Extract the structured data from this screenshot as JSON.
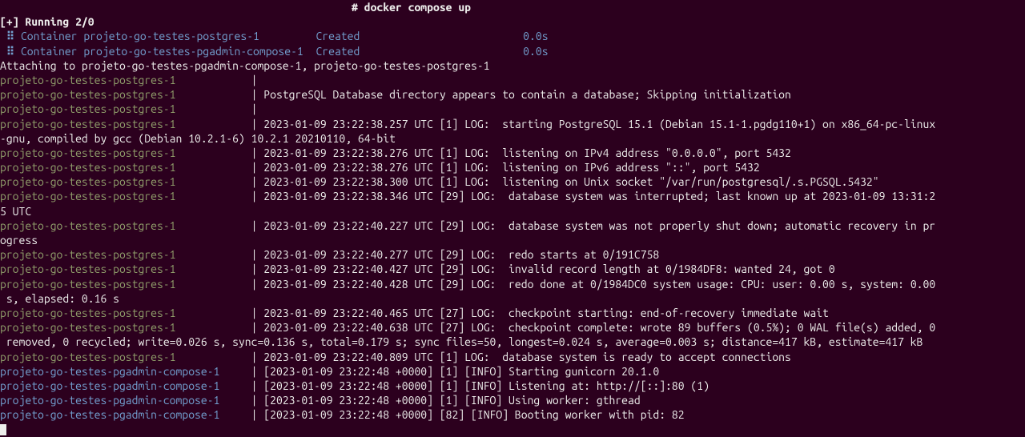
{
  "header": {
    "prefix": "                                                        # ",
    "command": "docker compose up"
  },
  "running": "[+] Running 2/0",
  "containers": [
    {
      "dots": " ⠿ ",
      "label": "Container projeto-go-testes-postgres-1         ",
      "status": "Created",
      "pad": "                          ",
      "time": "0.0s"
    },
    {
      "dots": " ⠿ ",
      "label": "Container projeto-go-testes-pgadmin-compose-1  ",
      "status": "Created",
      "pad": "                          ",
      "time": "0.0s"
    }
  ],
  "attaching": "Attaching to projeto-go-testes-pgadmin-compose-1, projeto-go-testes-postgres-1",
  "logs": [
    {
      "service": "projeto-go-testes-postgres-1",
      "color": "olive",
      "msg": ""
    },
    {
      "service": "projeto-go-testes-postgres-1",
      "color": "olive",
      "msg": "PostgreSQL Database directory appears to contain a database; Skipping initialization"
    },
    {
      "service": "projeto-go-testes-postgres-1",
      "color": "olive",
      "msg": ""
    },
    {
      "service": "projeto-go-testes-postgres-1",
      "color": "olive",
      "msg": "2023-01-09 23:22:38.257 UTC [1] LOG:  starting PostgreSQL 15.1 (Debian 15.1-1.pgdg110+1) on x86_64-pc-linux-gnu, compiled by gcc (Debian 10.2.1-6) 10.2.1 20210110, 64-bit"
    },
    {
      "service": "projeto-go-testes-postgres-1",
      "color": "olive",
      "msg": "2023-01-09 23:22:38.276 UTC [1] LOG:  listening on IPv4 address \"0.0.0.0\", port 5432"
    },
    {
      "service": "projeto-go-testes-postgres-1",
      "color": "olive",
      "msg": "2023-01-09 23:22:38.276 UTC [1] LOG:  listening on IPv6 address \"::\", port 5432"
    },
    {
      "service": "projeto-go-testes-postgres-1",
      "color": "olive",
      "msg": "2023-01-09 23:22:38.300 UTC [1] LOG:  listening on Unix socket \"/var/run/postgresql/.s.PGSQL.5432\""
    },
    {
      "service": "projeto-go-testes-postgres-1",
      "color": "olive",
      "msg": "2023-01-09 23:22:38.346 UTC [29] LOG:  database system was interrupted; last known up at 2023-01-09 13:31:25 UTC"
    },
    {
      "service": "projeto-go-testes-postgres-1",
      "color": "olive",
      "msg": "2023-01-09 23:22:40.227 UTC [29] LOG:  database system was not properly shut down; automatic recovery in progress"
    },
    {
      "service": "projeto-go-testes-postgres-1",
      "color": "olive",
      "msg": "2023-01-09 23:22:40.277 UTC [29] LOG:  redo starts at 0/191C758"
    },
    {
      "service": "projeto-go-testes-postgres-1",
      "color": "olive",
      "msg": "2023-01-09 23:22:40.427 UTC [29] LOG:  invalid record length at 0/1984DF8: wanted 24, got 0"
    },
    {
      "service": "projeto-go-testes-postgres-1",
      "color": "olive",
      "msg": "2023-01-09 23:22:40.428 UTC [29] LOG:  redo done at 0/1984DC0 system usage: CPU: user: 0.00 s, system: 0.00 s, elapsed: 0.16 s"
    },
    {
      "service": "projeto-go-testes-postgres-1",
      "color": "olive",
      "msg": "2023-01-09 23:22:40.465 UTC [27] LOG:  checkpoint starting: end-of-recovery immediate wait"
    },
    {
      "service": "projeto-go-testes-postgres-1",
      "color": "olive",
      "msg": "2023-01-09 23:22:40.638 UTC [27] LOG:  checkpoint complete: wrote 89 buffers (0.5%); 0 WAL file(s) added, 0 removed, 0 recycled; write=0.026 s, sync=0.136 s, total=0.179 s; sync files=50, longest=0.024 s, average=0.003 s; distance=417 kB, estimate=417 kB"
    },
    {
      "service": "projeto-go-testes-postgres-1",
      "color": "olive",
      "msg": "2023-01-09 23:22:40.809 UTC [1] LOG:  database system is ready to accept connections"
    },
    {
      "service": "projeto-go-testes-pgadmin-compose-1",
      "color": "blue",
      "msg": "[2023-01-09 23:22:48 +0000] [1] [INFO] Starting gunicorn 20.1.0"
    },
    {
      "service": "projeto-go-testes-pgadmin-compose-1",
      "color": "blue",
      "msg": "[2023-01-09 23:22:48 +0000] [1] [INFO] Listening at: http://[::]:80 (1)"
    },
    {
      "service": "projeto-go-testes-pgadmin-compose-1",
      "color": "blue",
      "msg": "[2023-01-09 23:22:48 +0000] [1] [INFO] Using worker: gthread"
    },
    {
      "service": "projeto-go-testes-pgadmin-compose-1",
      "color": "blue",
      "msg": "[2023-01-09 23:22:48 +0000] [82] [INFO] Booting worker with pid: 82"
    }
  ],
  "serviceWidth": 38
}
